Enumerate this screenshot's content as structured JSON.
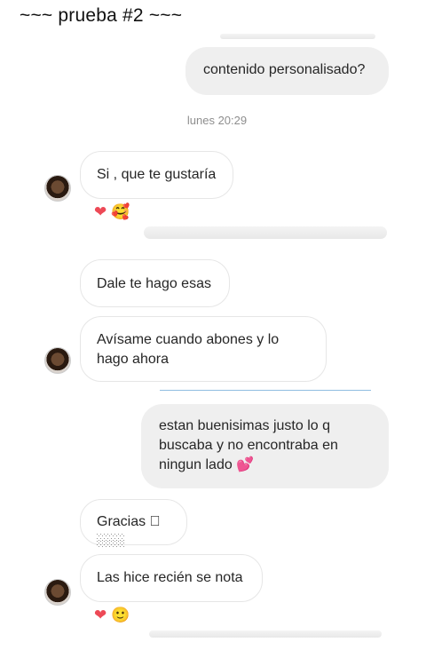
{
  "header": {
    "title": "~~~ prueba #2 ~~~"
  },
  "timestamp": "lunes 20:29",
  "messages": [
    {
      "side": "out",
      "text": "contenido personalisado?"
    },
    {
      "side": "in",
      "text": "Si , que te gustaría"
    },
    {
      "side": "in",
      "text": "Dale te hago esas"
    },
    {
      "side": "in",
      "text": "Avísame cuando abones y lo hago ahora"
    },
    {
      "side": "out",
      "text": "estan buenisimas justo lo q buscaba y no encontraba en ningun lado 💕"
    },
    {
      "side": "in",
      "text": "Gracias 🏼🏼🏼"
    },
    {
      "side": "in",
      "text": "Las hice recién se nota"
    }
  ],
  "reactions": {
    "r1": {
      "heart": "❤",
      "other": "🥰"
    },
    "r2": {
      "heart": "❤",
      "other": "🙂"
    }
  },
  "colors": {
    "heart": "#ed4956",
    "outgoing_bubble": "#efefef",
    "divider_line": "#8fbde0"
  }
}
